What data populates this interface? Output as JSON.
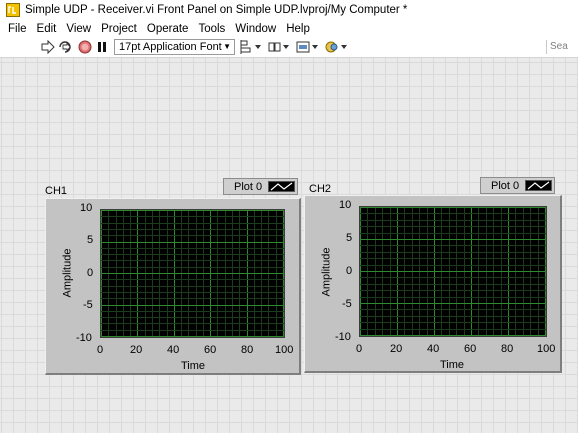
{
  "window": {
    "title": "Simple UDP - Receiver.vi Front Panel on Simple UDP.lvproj/My Computer *"
  },
  "menu": [
    "File",
    "Edit",
    "View",
    "Project",
    "Operate",
    "Tools",
    "Window",
    "Help"
  ],
  "toolbar": {
    "font_value": "17pt Application Font",
    "search_text": "Sea"
  },
  "charts": [
    {
      "label": "CH1",
      "legend": "Plot 0",
      "xlabel": "Time",
      "ylabel": "Amplitude",
      "x_ticks": [
        "0",
        "20",
        "40",
        "60",
        "80",
        "100"
      ],
      "y_ticks": [
        "10",
        "5",
        "0",
        "-5",
        "-10"
      ]
    },
    {
      "label": "CH2",
      "legend": "Plot 0",
      "xlabel": "Time",
      "ylabel": "Amplitude",
      "x_ticks": [
        "0",
        "20",
        "40",
        "60",
        "80",
        "100"
      ],
      "y_ticks": [
        "10",
        "5",
        "0",
        "-5",
        "-10"
      ]
    }
  ],
  "chart_data": [
    {
      "type": "line",
      "title": "CH1",
      "xlabel": "Time",
      "ylabel": "Amplitude",
      "xlim": [
        0,
        100
      ],
      "ylim": [
        -10,
        10
      ],
      "series": [
        {
          "name": "Plot 0",
          "x": [],
          "y": []
        }
      ],
      "grid": true,
      "legend": "top-right"
    },
    {
      "type": "line",
      "title": "CH2",
      "xlabel": "Time",
      "ylabel": "Amplitude",
      "xlim": [
        0,
        100
      ],
      "ylim": [
        -10,
        10
      ],
      "series": [
        {
          "name": "Plot 0",
          "x": [],
          "y": []
        }
      ],
      "grid": true,
      "legend": "top-right"
    }
  ]
}
